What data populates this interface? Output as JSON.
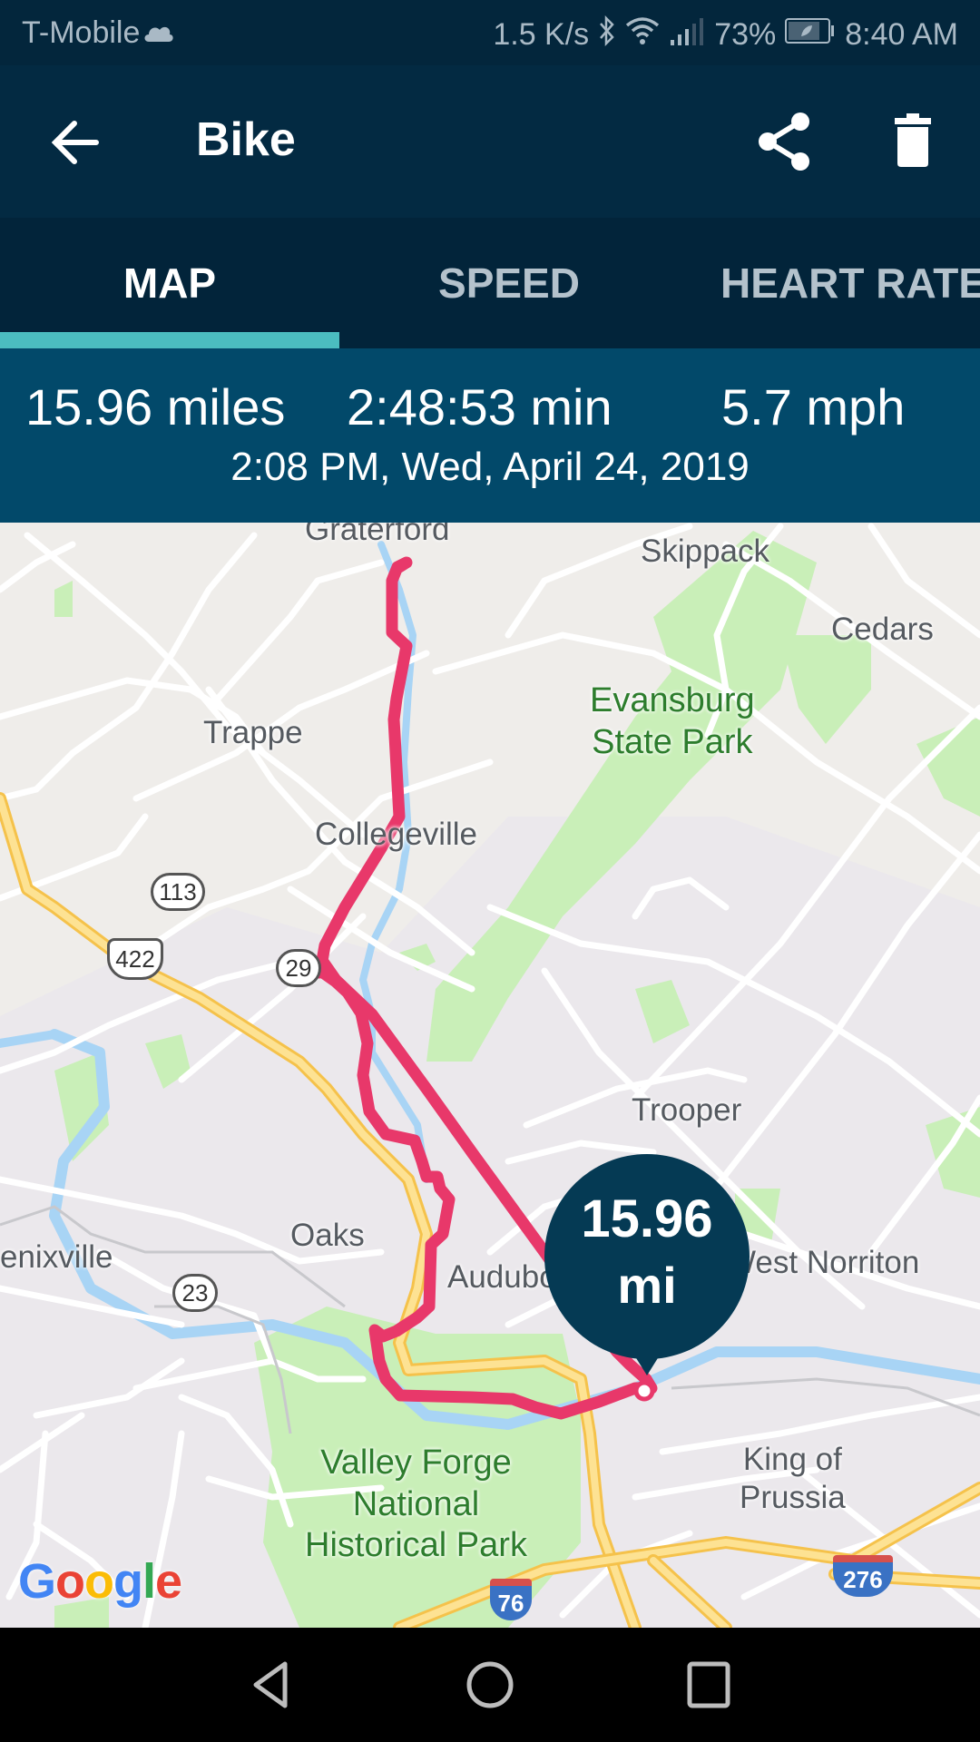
{
  "status_bar": {
    "carrier": "T-Mobile",
    "net_speed": "1.5 K/s",
    "battery": "73%",
    "time": "8:40 AM",
    "icons": [
      "cloud-icon",
      "bluetooth-icon",
      "wifi-icon",
      "signal-icon",
      "battery-icon"
    ]
  },
  "app_bar": {
    "title": "Bike",
    "back_icon": "arrow-left-icon",
    "share_icon": "share-icon",
    "delete_icon": "trash-icon"
  },
  "tabs": [
    {
      "label": "MAP",
      "active": true
    },
    {
      "label": "SPEED",
      "active": false
    },
    {
      "label": "HEART RATE",
      "active": false
    }
  ],
  "summary": {
    "distance": "15.96 miles",
    "duration": "2:48:53 min",
    "speed": "5.7 mph",
    "datetime": "2:08 PM, Wed, April 24, 2019"
  },
  "map": {
    "labels": {
      "graterford": "Graterford",
      "skippack": "Skippack",
      "cedars": "Cedars",
      "trappe": "Trappe",
      "evansburg": "Evansburg\nState Park",
      "collegeville": "Collegeville",
      "trooper": "Trooper",
      "oaks": "Oaks",
      "phoenixville": "enixville",
      "audubon": "Audubon",
      "west_norriton": "West Norriton",
      "valley_forge": "Valley Forge\nNational\nHistorical Park",
      "king_of_prussia": "King of\nPrussia"
    },
    "shields": {
      "r113": "113",
      "r422": "422",
      "r29": "29",
      "r23": "23",
      "i76": "76",
      "i276": "276"
    },
    "marker": {
      "value": "15.96",
      "unit": "mi"
    },
    "attribution": "Google",
    "route_color": "#e8386a"
  },
  "nav_bar": {
    "back": "nav-back-icon",
    "home": "nav-home-icon",
    "recents": "nav-recents-icon"
  }
}
